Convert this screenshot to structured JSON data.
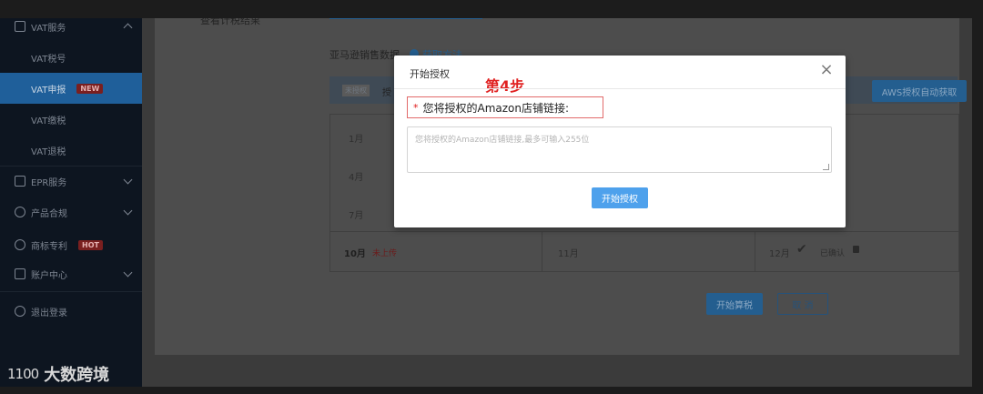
{
  "sidebar": {
    "vat": "VAT服务",
    "vat_items": [
      "VAT税号",
      "VAT申报",
      "VAT缴税",
      "VAT退税"
    ],
    "new_badge": "NEW",
    "epr": "EPR服务",
    "product": "产品合规",
    "trademark": "商标专利",
    "hot_badge": "HOT",
    "account": "账户中心",
    "logout": "退出登录"
  },
  "logo": {
    "mark": "1100",
    "text": "大数跨境"
  },
  "main": {
    "top_label": "查看计税结果",
    "section_title": "亚马逊销售数据",
    "help_link": "获取方法",
    "status_badge": "未授权",
    "status_text": "授",
    "aws_button": "AWS授权自动获取",
    "months": [
      "1月",
      "4月",
      "7月",
      "10月",
      "11月",
      "12月"
    ],
    "not_uploaded": "未上传",
    "confirmed": "已确认",
    "calc_button": "开始算税",
    "cancel_button": "取 消"
  },
  "modal": {
    "title": "开始授权",
    "step": "第4步",
    "required_mark": "*",
    "label": "您将授权的Amazon店铺链接:",
    "placeholder": "您将授权的Amazon店铺链接,最多可输入255位",
    "submit": "开始授权"
  },
  "colors": {
    "accent": "#4ea1ec",
    "step_red": "#e02020",
    "sidebar_bg": "#0d1520"
  }
}
